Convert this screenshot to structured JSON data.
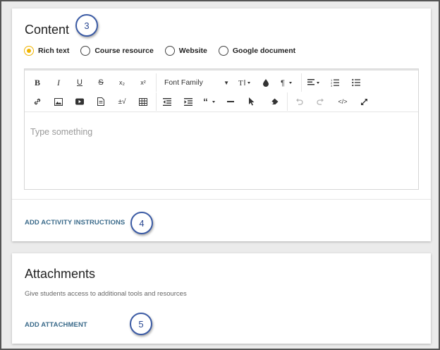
{
  "content_section": {
    "title": "Content",
    "radio_options": [
      {
        "label": "Rich text",
        "selected": true
      },
      {
        "label": "Course resource",
        "selected": false
      },
      {
        "label": "Website",
        "selected": false
      },
      {
        "label": "Google document",
        "selected": false
      }
    ],
    "toolbar": {
      "font_family_label": "Font Family",
      "bold": "B",
      "italic": "I",
      "underline": "U",
      "strikethrough": "S",
      "subscript": "x₂",
      "superscript": "x²"
    },
    "editor_placeholder": "Type something",
    "add_instructions_label": "ADD ACTIVITY INSTRUCTIONS"
  },
  "attachments_section": {
    "title": "Attachments",
    "description": "Give students access to additional tools and resources",
    "add_attachment_label": "ADD ATTACHMENT"
  },
  "callouts": {
    "content": "3",
    "instructions": "4",
    "attachment": "5"
  },
  "colors": {
    "radio_selected": "#f0b400",
    "link": "#3a6a8a",
    "callout_border": "#3b5ba5"
  }
}
